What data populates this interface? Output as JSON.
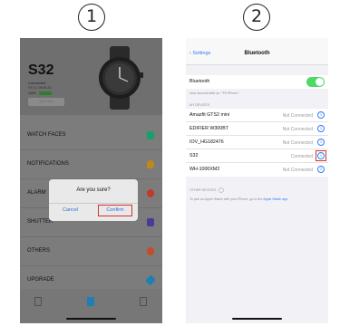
{
  "steps": {
    "one": "1",
    "two": "2"
  },
  "watch_app": {
    "device_name": "S32",
    "status": "Connected",
    "mac": "F8:CC:1B:8B:33",
    "battery": "100%",
    "sync_label": "Sync Now",
    "menu": [
      {
        "label": "WATCH FACES",
        "icon": "watch-faces-icon",
        "color": "#1a9e6c"
      },
      {
        "label": "NOTIFICATIONS",
        "icon": "chat-icon",
        "color": "#c2871a"
      },
      {
        "label": "ALARM",
        "icon": "alarm-icon",
        "color": "#c0392b"
      },
      {
        "label": "SHUTTER",
        "icon": "camera-icon",
        "color": "#4a3a9a"
      },
      {
        "label": "OTHERS",
        "icon": "settings-icon",
        "color": "#c84a2a"
      },
      {
        "label": "UPGRADE",
        "icon": "upgrade-icon",
        "color": "#1d7fb3"
      }
    ],
    "dialog": {
      "title": "Are you sure?",
      "cancel_label": "Cancel",
      "confirm_label": "Confirm"
    },
    "nav": [
      "home-icon",
      "device-icon",
      "profile-icon"
    ]
  },
  "bluetooth": {
    "back_label": "Settings",
    "title": "Bluetooth",
    "toggle_label": "Bluetooth",
    "toggle_on": true,
    "discoverable_note": "Now discoverable as \"\"F8 iPhone\".",
    "my_devices_header": "MY DEVICES",
    "devices": [
      {
        "name": "Amazfit GTS2 mini",
        "status": "Not Connected"
      },
      {
        "name": "EDIFIER W300BT",
        "status": "Not Connected"
      },
      {
        "name": "IOV_HG182476",
        "status": "Not Connected"
      },
      {
        "name": "S32",
        "status": "Connected"
      },
      {
        "name": "WH-1000XM2",
        "status": "Not Connected"
      }
    ],
    "other_devices_header": "OTHER DEVICES",
    "pair_note_prefix": "To pair an Apple Watch with your iPhone, go to the",
    "pair_note_link": "Apple Watch app."
  },
  "colors": {
    "accent_blue": "#2f7cf6",
    "highlight_red": "#d3332f",
    "toggle_green": "#4cd964"
  }
}
